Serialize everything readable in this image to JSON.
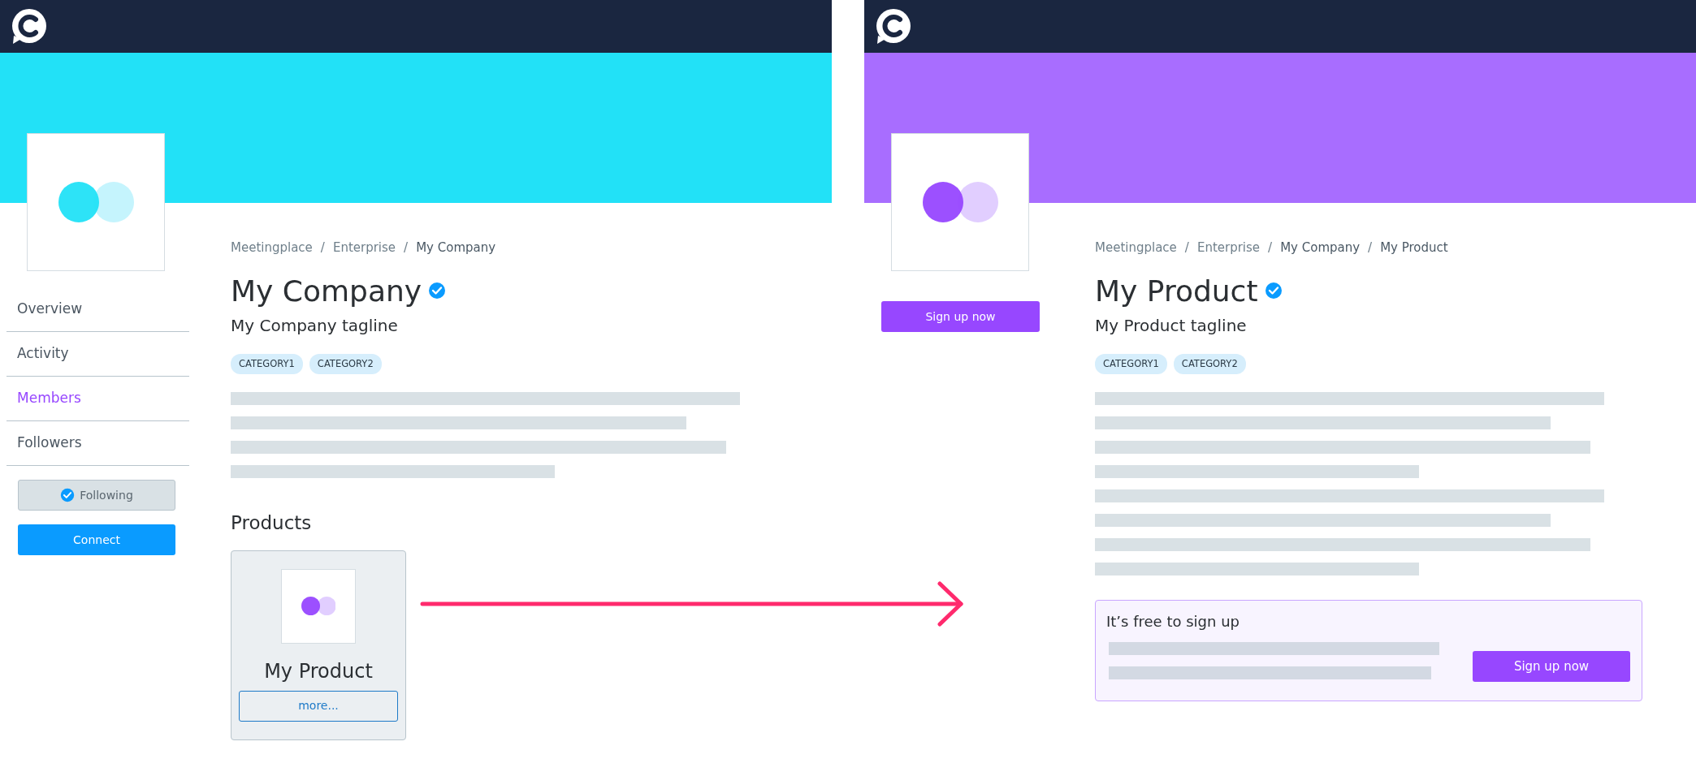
{
  "screens": [
    {
      "kind": "company",
      "color": "#22e1f7",
      "breadcrumb": [
        {
          "kind": "link",
          "label": "Meetingplace",
          "bold": false
        },
        {
          "kind": "separator",
          "label": "/"
        },
        {
          "kind": "link",
          "label": "Enterprise",
          "bold": false
        },
        {
          "kind": "separator",
          "label": "/"
        },
        {
          "kind": "link",
          "label": "My Company",
          "bold": true
        }
      ],
      "title": "My Company",
      "verified": true,
      "tagline": "My Company tagline",
      "tags": [
        "CATEGORY1",
        "CATEGORY2"
      ],
      "sidebar": {
        "items": [
          {
            "label": "Overview",
            "selected": false
          },
          {
            "label": "Activity",
            "selected": false
          },
          {
            "label": "Members",
            "selected": true
          },
          {
            "label": "Followers",
            "selected": false
          }
        ],
        "buttons": [
          {
            "kind": "follow",
            "label": "Following",
            "checked": true
          },
          {
            "kind": "connect",
            "label": "Connect"
          }
        ]
      },
      "products": {
        "heading": "Products",
        "items": [
          {
            "name": "My Product",
            "button": "more..."
          }
        ]
      }
    },
    {
      "kind": "product",
      "color": "#a86dff",
      "breadcrumb": [
        {
          "kind": "link",
          "label": "Meetingplace",
          "bold": false
        },
        {
          "kind": "separator",
          "label": "/"
        },
        {
          "kind": "link",
          "label": "Enterprise",
          "bold": false
        },
        {
          "kind": "separator",
          "label": "/"
        },
        {
          "kind": "link",
          "label": "My Company",
          "bold": true
        },
        {
          "kind": "separator",
          "label": "/"
        },
        {
          "kind": "link",
          "label": "My Product",
          "bold": true
        }
      ],
      "title": "My Product",
      "verified": true,
      "tagline": "My Product tagline",
      "tags": [
        "CATEGORY1",
        "CATEGORY2"
      ],
      "sidebar": {
        "buttons": [
          {
            "kind": "signup",
            "label": "Sign up now"
          }
        ]
      },
      "signup_box": {
        "title": "It’s free to sign up",
        "button": "Sign up now"
      }
    }
  ]
}
